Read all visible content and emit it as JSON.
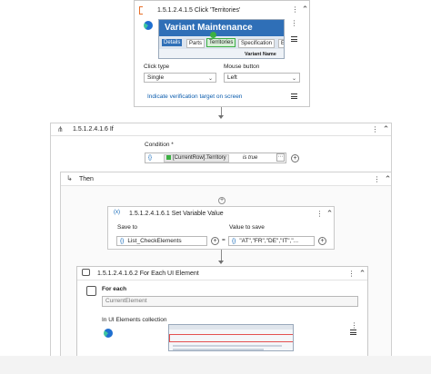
{
  "click_activity": {
    "title": "1.5.1.2.4.1.5  Click 'Territories'",
    "preview": {
      "app_title": "Variant Maintenance",
      "tabs": [
        "Details",
        "Parts",
        "Territories",
        "Specification",
        "E"
      ],
      "column_label": "Variant Name"
    },
    "click_type_label": "Click type",
    "click_type_value": "Single",
    "mouse_button_label": "Mouse button",
    "mouse_button_value": "Left",
    "verify_link": "Indicate verification target on screen"
  },
  "if_activity": {
    "title": "1.5.1.2.4.1.6  If",
    "condition_label": "Condition *",
    "condition_variable": "[CurrentRow].Territory",
    "condition_keyword": "is true",
    "then_label": "Then"
  },
  "set_variable": {
    "title": "1.5.1.2.4.1.6.1  Set Variable Value",
    "save_to_label": "Save to",
    "save_to_value": "List_CheckElements",
    "value_label": "Value to save",
    "value_value": "\"AT\",\"FR\",\"DE\",\"IT\",\"...",
    "equals": "="
  },
  "for_each": {
    "title": "1.5.1.2.4.1.6.2  For Each UI Element",
    "for_each_label": "For each",
    "current_element": "CurrentElement",
    "collection_label": "In UI Elements collection"
  },
  "icons": {
    "expand": "»",
    "collapse": "«",
    "more": "⋮",
    "plus": "+",
    "hamburger": "≡"
  },
  "colors": {
    "accent": "#0b63b5",
    "preview_header": "#2f6fb7",
    "highlight": "#3cb043",
    "link": "#0b5cad",
    "orange": "#e8702a"
  }
}
